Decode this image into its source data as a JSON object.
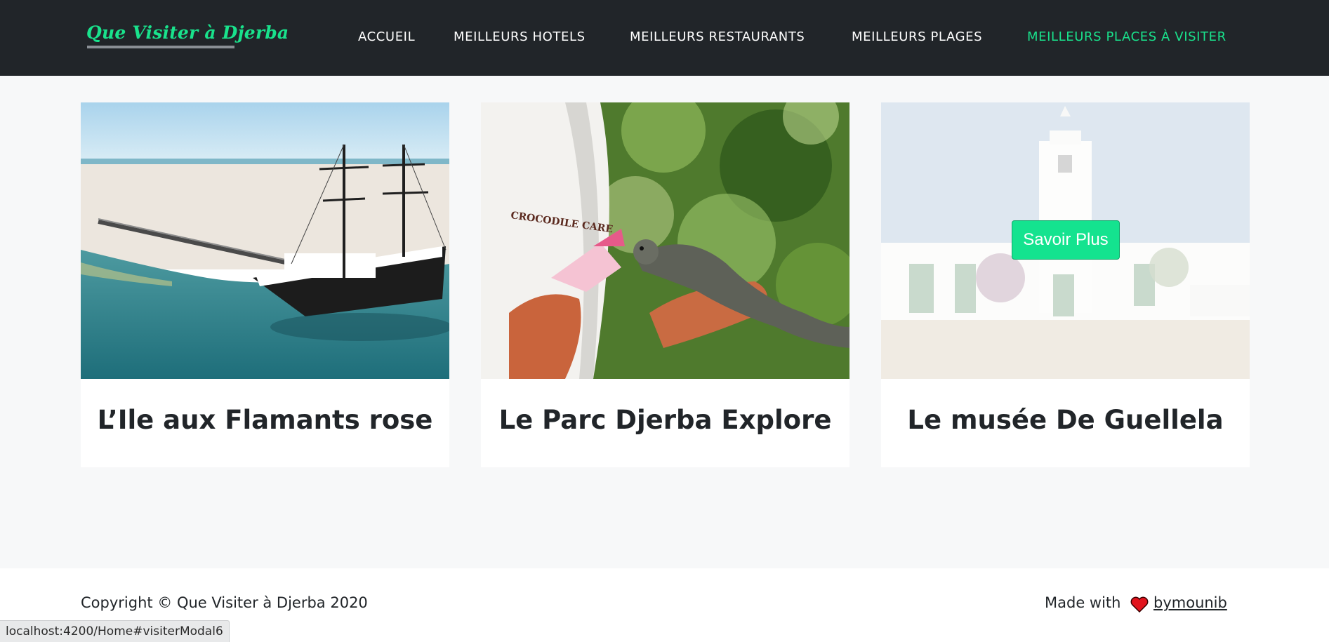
{
  "navbar": {
    "brand": "Que Visiter à Djerba",
    "links": [
      {
        "label": "ACCUEIL",
        "active": false
      },
      {
        "label": "MEILLEURS HOTELS",
        "active": false
      },
      {
        "label": "MEILLEURS RESTAURANTS",
        "active": false
      },
      {
        "label": "MEILLEURS PLAGES",
        "active": false
      },
      {
        "label": "MEILLEURS PLACES À VISITER",
        "active": true
      }
    ],
    "colors": {
      "background": "#212529",
      "accent": "#19e28c"
    }
  },
  "cards": [
    {
      "title": "L’Ile aux Flamants rose",
      "image": "pirate-ship-photo"
    },
    {
      "title": "Le Parc Djerba Explore",
      "image": "iguana-photo"
    },
    {
      "title": "Le musée De Guellela",
      "image": "museum-building-photo",
      "hover_button": "Savoir Plus"
    }
  ],
  "footer": {
    "copyright": "Copyright © Que Visiter à Djerba 2020",
    "made_with": "Made with",
    "heart_icon": "heart-icon",
    "author": "bymounib",
    "heart_color": "#e1141d"
  },
  "status_bar": {
    "url": "localhost:4200/Home#visiterModal6"
  }
}
